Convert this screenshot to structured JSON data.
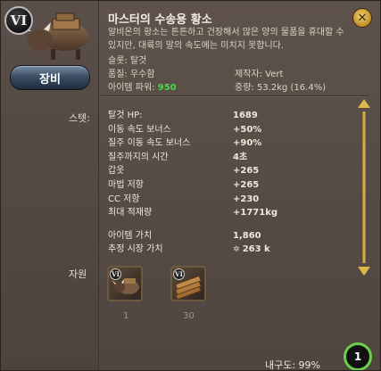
{
  "item": {
    "tier": "VI",
    "title": "마스터의 수송용 황소",
    "description": "알비온의 황소는 튼튼하고 건장해서 많은 양의 물품을 휴대할 수 있지만, 대륙의 말의 속도에는 미치지 못합니다.",
    "slot": "슬롯: 탈것",
    "quality_label": "품질: 우수함",
    "crafter_label": "제작자: Vert",
    "power_label": "아이템 파워:",
    "power_value": "950",
    "weight_label": "중량: 53.2kg (16.4%)"
  },
  "buttons": {
    "equip": "장비"
  },
  "sections": {
    "stats": "스텟:",
    "materials": "자원"
  },
  "stats": [
    {
      "label": "탈것 HP:",
      "value": "1689"
    },
    {
      "label": "이동 속도 보너스",
      "value": "+50%"
    },
    {
      "label": "질주 이동 속도 보너스",
      "value": "+90%"
    },
    {
      "label": "질주까지의 시간",
      "value": "4초"
    },
    {
      "label": "갑옷",
      "value": "+265"
    },
    {
      "label": "마법 저항",
      "value": "+265"
    },
    {
      "label": "CC 저항",
      "value": "+230"
    },
    {
      "label": "최대 적재량",
      "value": "+1771kg"
    }
  ],
  "value": {
    "item_value_label": "아이템 가치",
    "item_value": "1,860",
    "market_label": "추정 시장 가치",
    "market_value": "263 k"
  },
  "materials": [
    {
      "icon": "ox-icon",
      "tier": "VI",
      "qty": "1"
    },
    {
      "icon": "planks-icon",
      "tier": "VI",
      "qty": "30"
    }
  ],
  "footer": {
    "durability": "내구도: 99%",
    "count": "1"
  },
  "colors": {
    "power": "#4cd44c",
    "accent": "#e0b84a",
    "ring": "#6ad04a"
  }
}
